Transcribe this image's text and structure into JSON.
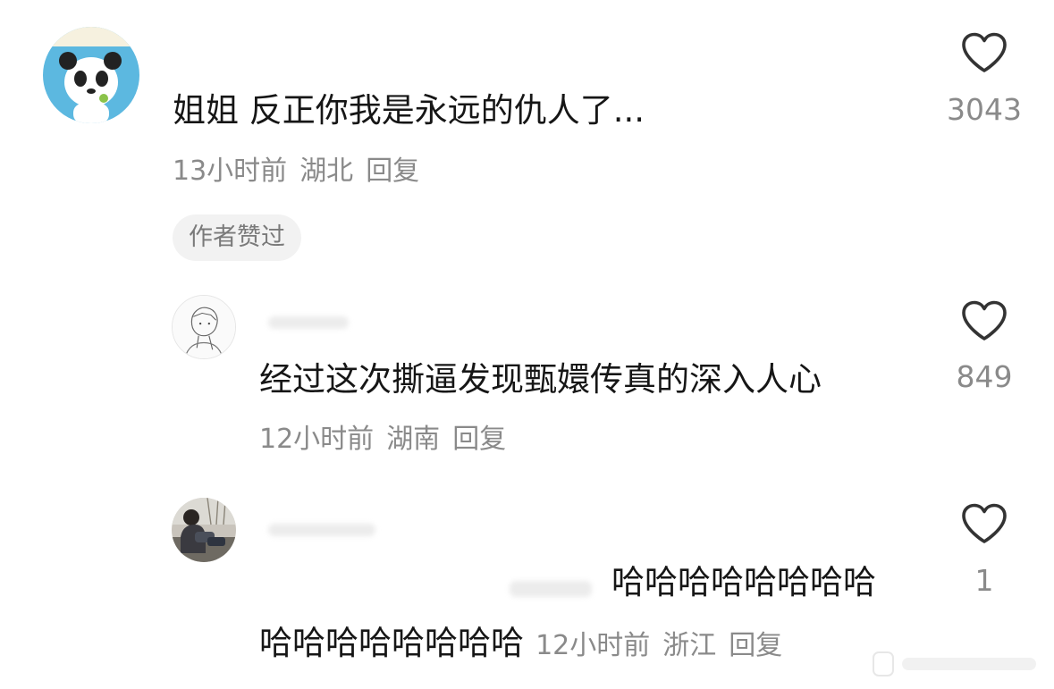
{
  "comments": [
    {
      "text": "姐姐 反正你我是永远的仇人了...",
      "time": "13小时前",
      "location": "湖北",
      "reply_label": "回复",
      "likes": "3043",
      "badge": "作者赞过",
      "avatar_icon": "panda-avatar"
    },
    {
      "text": "经过这次撕逼发现甄嬛传真的深入人心",
      "time": "12小时前",
      "location": "湖南",
      "reply_label": "回复",
      "likes": "849",
      "avatar_icon": "sketch-avatar"
    },
    {
      "text_line1": "哈哈哈哈哈哈哈哈",
      "text_line2": "哈哈哈哈哈哈哈哈",
      "time": "12小时前",
      "location": "浙江",
      "reply_label": "回复",
      "likes": "1",
      "avatar_icon": "photo-avatar"
    }
  ],
  "colors": {
    "text": "#161616",
    "meta": "#8a8a8a",
    "badge_bg": "#f2f2f2",
    "heart_stroke": "#333333"
  }
}
